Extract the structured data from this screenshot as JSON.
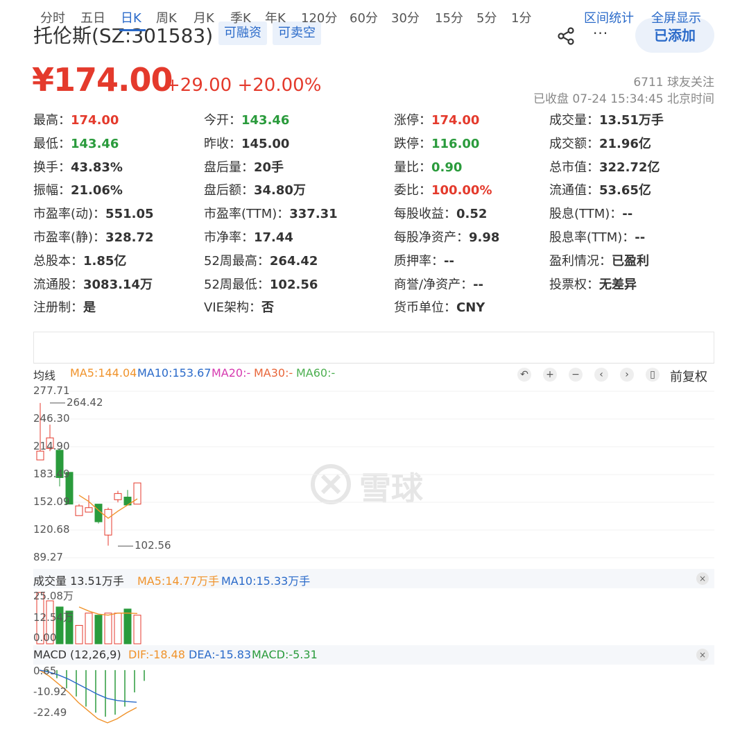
{
  "header": {
    "title": "托伦斯(SZ:301583)",
    "tags": [
      "可融资",
      "可卖空"
    ],
    "more_label": "···",
    "add_label": "已添加"
  },
  "quote": {
    "price": "¥174.00",
    "change": "+29.00 +20.00%",
    "followers": "6711 球友关注",
    "status": "已收盘 07-24 15:34:45 北京时间"
  },
  "stats": [
    [
      {
        "k": "最高：",
        "v": "174.00",
        "c": "red"
      },
      {
        "k": "今开：",
        "v": "143.46",
        "c": "green"
      },
      {
        "k": "涨停：",
        "v": "174.00",
        "c": "red"
      },
      {
        "k": "成交量：",
        "v": "13.51万手",
        "c": ""
      }
    ],
    [
      {
        "k": "最低：",
        "v": "143.46",
        "c": "green"
      },
      {
        "k": "昨收：",
        "v": "145.00",
        "c": ""
      },
      {
        "k": "跌停：",
        "v": "116.00",
        "c": "green"
      },
      {
        "k": "成交额：",
        "v": "21.96亿",
        "c": ""
      }
    ],
    [
      {
        "k": "换手：",
        "v": "43.83%",
        "c": ""
      },
      {
        "k": "盘后量：",
        "v": "20手",
        "c": ""
      },
      {
        "k": "量比：",
        "v": "0.90",
        "c": "green"
      },
      {
        "k": "总市值：",
        "v": "322.72亿",
        "c": ""
      }
    ],
    [
      {
        "k": "振幅：",
        "v": "21.06%",
        "c": ""
      },
      {
        "k": "盘后额：",
        "v": "34.80万",
        "c": ""
      },
      {
        "k": "委比：",
        "v": "100.00%",
        "c": "red"
      },
      {
        "k": "流通值：",
        "v": "53.65亿",
        "c": ""
      }
    ],
    [
      {
        "k": "市盈率(动)：",
        "v": "551.05",
        "c": ""
      },
      {
        "k": "市盈率(TTM)：",
        "v": "337.31",
        "c": ""
      },
      {
        "k": "每股收益：",
        "v": "0.52",
        "c": ""
      },
      {
        "k": "股息(TTM)：",
        "v": "--",
        "c": ""
      }
    ],
    [
      {
        "k": "市盈率(静)：",
        "v": "328.72",
        "c": ""
      },
      {
        "k": "市净率：",
        "v": "17.44",
        "c": ""
      },
      {
        "k": "每股净资产：",
        "v": "9.98",
        "c": ""
      },
      {
        "k": "股息率(TTM)：",
        "v": "--",
        "c": ""
      }
    ],
    [
      {
        "k": "总股本：",
        "v": "1.85亿",
        "c": ""
      },
      {
        "k": "52周最高：",
        "v": "264.42",
        "c": ""
      },
      {
        "k": "质押率：",
        "v": "--",
        "c": ""
      },
      {
        "k": "盈利情况：",
        "v": "已盈利",
        "c": ""
      }
    ],
    [
      {
        "k": "流通股：",
        "v": "3083.14万",
        "c": ""
      },
      {
        "k": "52周最低：",
        "v": "102.56",
        "c": ""
      },
      {
        "k": "商誉/净资产：",
        "v": "--",
        "c": ""
      },
      {
        "k": "投票权：",
        "v": "无差异",
        "c": ""
      }
    ],
    [
      {
        "k": "注册制：",
        "v": "是",
        "c": ""
      },
      {
        "k": "VIE架构：",
        "v": "否",
        "c": ""
      },
      {
        "k": "货币单位：",
        "v": "CNY",
        "c": ""
      }
    ]
  ],
  "tabs": [
    "分时",
    "五日",
    "日K",
    "周K",
    "月K",
    "季K",
    "年K",
    "120分",
    "60分",
    "30分",
    "15分",
    "5分",
    "1分"
  ],
  "active_tab": "日K",
  "right_tabs": [
    "区间统计",
    "全屏显示"
  ],
  "kline_legend": {
    "label": "均线",
    "ma5": "MA5:144.04",
    "ma10": "MA10:153.67",
    "ma20": "MA20:-",
    "ma30": "MA30:-",
    "ma60": "MA60:-"
  },
  "controls": {
    "undo": "↶",
    "zoom_in": "+",
    "zoom_out": "−",
    "prev": "‹",
    "next": "›",
    "candle": "▯",
    "adjust_label": "前复权"
  },
  "volume_legend": {
    "label": "成交量 13.51万手",
    "ma5": "MA5:14.77万手",
    "ma10": "MA10:15.33万手"
  },
  "macd_legend": {
    "label": "MACD (12,26,9)",
    "dif": "DIF:-18.48",
    "dea": "DEA:-15.83",
    "macd": "MACD:-5.31"
  },
  "close_glyph": "×",
  "watermark": "雪球",
  "colors": {
    "up": "#e43a2c",
    "down": "#2a9b3c",
    "link": "#2a6ac9",
    "ma5": "#f0932b",
    "ma10": "#2a6ac9",
    "ma20": "#d63ab0",
    "ma30": "#e8663a",
    "ma60": "#4caf50"
  },
  "chart_data": [
    {
      "type": "candlestick",
      "y_ticks": [
        "277.71",
        "246.30",
        "214.90",
        "183.49",
        "152.09",
        "120.68",
        "89.27"
      ],
      "ylim": [
        89.27,
        277.71
      ],
      "annotations": [
        {
          "text": "264.42",
          "value": 264.42,
          "index": 1
        },
        {
          "text": "102.56",
          "value": 102.56,
          "index": 8
        }
      ],
      "candles": [
        {
          "o": 200,
          "c": 210,
          "h": 264.42,
          "l": 200
        },
        {
          "o": 213,
          "c": 225,
          "h": 240,
          "l": 210
        },
        {
          "o": 211,
          "c": 180,
          "h": 213,
          "l": 170
        },
        {
          "o": 186,
          "c": 150,
          "h": 186,
          "l": 150
        },
        {
          "o": 137,
          "c": 148,
          "h": 150,
          "l": 137
        },
        {
          "o": 141,
          "c": 146,
          "h": 160,
          "l": 141
        },
        {
          "o": 150,
          "c": 130,
          "h": 150,
          "l": 128
        },
        {
          "o": 115,
          "c": 144,
          "h": 146,
          "l": 103
        },
        {
          "o": 155,
          "c": 162,
          "h": 165,
          "l": 152
        },
        {
          "o": 158,
          "c": 149,
          "h": 166,
          "l": 149
        },
        {
          "o": 150,
          "c": 174,
          "h": 174,
          "l": 150
        }
      ],
      "ma5": [
        null,
        null,
        null,
        null,
        160,
        153,
        143,
        134,
        142,
        149,
        156
      ]
    },
    {
      "type": "bar",
      "title": "成交量",
      "y_ticks": [
        "25.08万",
        "12.54万",
        "0.00"
      ],
      "ylim": [
        0,
        25.08
      ],
      "values": [
        25.08,
        21,
        18,
        16,
        9,
        15,
        14,
        15,
        15,
        17,
        14
      ],
      "directions": [
        "up",
        "up",
        "down",
        "down",
        "up",
        "up",
        "down",
        "up",
        "up",
        "down",
        "up"
      ],
      "ma5": [
        null,
        null,
        null,
        null,
        18,
        16,
        14.5,
        14,
        15,
        15,
        14.8
      ]
    },
    {
      "type": "macd",
      "y_ticks": [
        "0.65",
        "-10.92",
        "-22.49"
      ],
      "ylim": [
        -24,
        0.65
      ],
      "dif": [
        0,
        -3,
        -7,
        -11,
        -16,
        -20,
        -24,
        -26,
        -24,
        -21,
        -18.48
      ],
      "dea": [
        0,
        -1,
        -2.5,
        -4.5,
        -7,
        -9.5,
        -12,
        -14,
        -15,
        -15.5,
        -15.83
      ],
      "macd": [
        -1,
        -4,
        -9,
        -13,
        -18,
        -21,
        -23,
        -22,
        -18,
        -11,
        -5.31
      ]
    }
  ]
}
